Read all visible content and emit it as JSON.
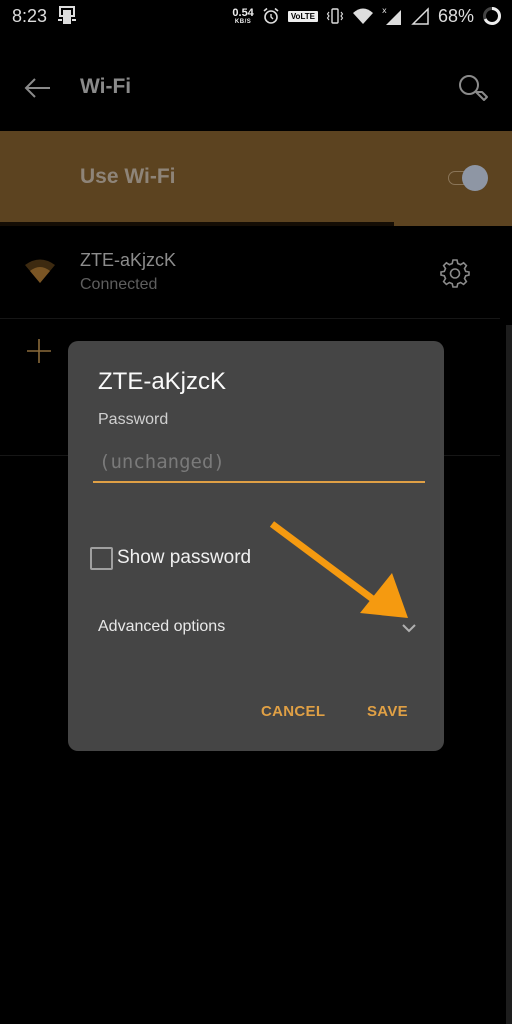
{
  "status_bar": {
    "time": "8:23",
    "net_speed_value": "0.54",
    "net_speed_unit": "KB/S",
    "volte_label": "VoLTE",
    "battery_percent": "68%",
    "icons": [
      "screencast-notification-icon",
      "alarm-icon",
      "volte-icon",
      "vibrate-icon",
      "wifi-icon",
      "signal-no-data-icon",
      "signal-empty-icon",
      "battery-ring-icon"
    ]
  },
  "toolbar": {
    "title": "Wi-Fi",
    "back_icon": "arrow-left-icon",
    "search_icon": "search-icon"
  },
  "wifi_toggle": {
    "label": "Use Wi-Fi",
    "enabled": true,
    "scan_progress_percent": 77
  },
  "networks": [
    {
      "ssid": "ZTE-aKjzcK",
      "status": "Connected",
      "icon": "wifi-signal-icon",
      "action_icon": "gear-icon"
    }
  ],
  "add_network_icon": "plus-icon",
  "dialog": {
    "title": "ZTE-aKjzcK",
    "password_label": "Password",
    "password_value": "",
    "password_placeholder": "(unchanged)",
    "show_password_label": "Show password",
    "show_password_checked": false,
    "advanced_options_label": "Advanced options",
    "cancel_label": "CANCEL",
    "save_label": "SAVE"
  },
  "colors": {
    "accent": "#e0a045",
    "banner": "#5c4320",
    "dialog_bg": "#454545",
    "annotation_arrow": "#f59a10"
  }
}
